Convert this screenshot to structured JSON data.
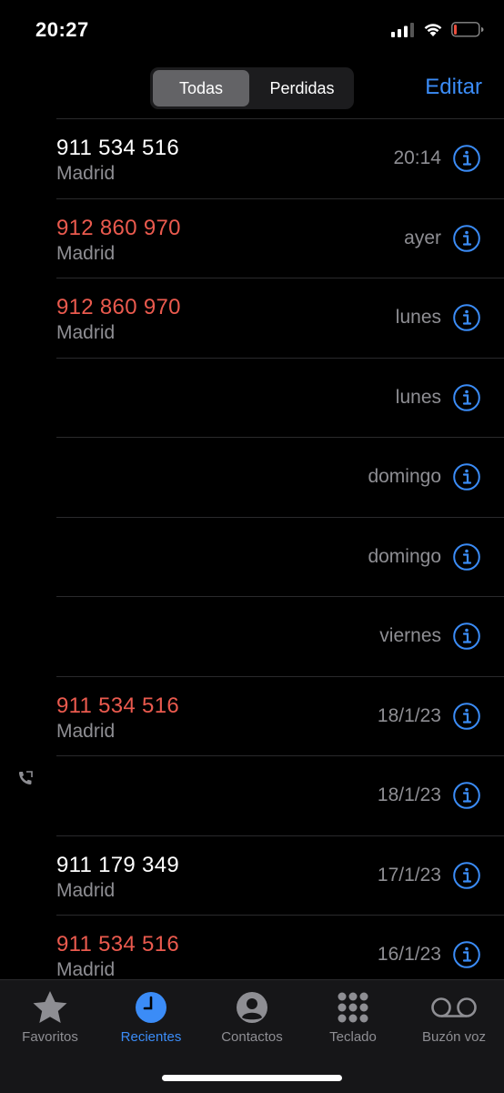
{
  "status": {
    "time": "20:27",
    "icons": [
      "signal-icon",
      "wifi-icon",
      "battery-icon"
    ]
  },
  "topbar": {
    "segments": [
      "Todas",
      "Perdidas"
    ],
    "selected": "Todas",
    "edit_label": "Editar"
  },
  "calls": [
    {
      "number": "911 534 516",
      "location": "Madrid",
      "when": "20:14",
      "missed": false
    },
    {
      "number": "912 860 970",
      "location": "Madrid",
      "when": "ayer",
      "missed": true
    },
    {
      "number": "912 860 970",
      "location": "Madrid",
      "when": "lunes",
      "missed": true
    },
    {
      "number": "",
      "location": "",
      "when": "lunes",
      "missed": false
    },
    {
      "number": "",
      "location": "",
      "when": "domingo",
      "missed": false
    },
    {
      "number": "",
      "location": "",
      "when": "domingo",
      "missed": false
    },
    {
      "number": "",
      "location": "",
      "when": "viernes",
      "missed": false
    },
    {
      "number": "911 534 516",
      "location": "Madrid",
      "when": "18/1/23",
      "missed": true
    },
    {
      "number": "",
      "location": "",
      "when": "18/1/23",
      "missed": false
    },
    {
      "number": "911 179 349",
      "location": "Madrid",
      "when": "17/1/23",
      "missed": false
    },
    {
      "number": "911 534 516",
      "location": "Madrid",
      "when": "16/1/23",
      "missed": true
    }
  ],
  "tabs": [
    {
      "label": "Favoritos",
      "icon": "star-icon",
      "active": false
    },
    {
      "label": "Recientes",
      "icon": "clock-icon",
      "active": true
    },
    {
      "label": "Contactos",
      "icon": "person-icon",
      "active": false
    },
    {
      "label": "Teclado",
      "icon": "keypad-icon",
      "active": false
    },
    {
      "label": "Buzón voz",
      "icon": "voicemail-icon",
      "active": false
    }
  ],
  "colors": {
    "accent": "#3b8cf7",
    "missed": "#ea5a4e",
    "secondary": "#8e8e93"
  }
}
